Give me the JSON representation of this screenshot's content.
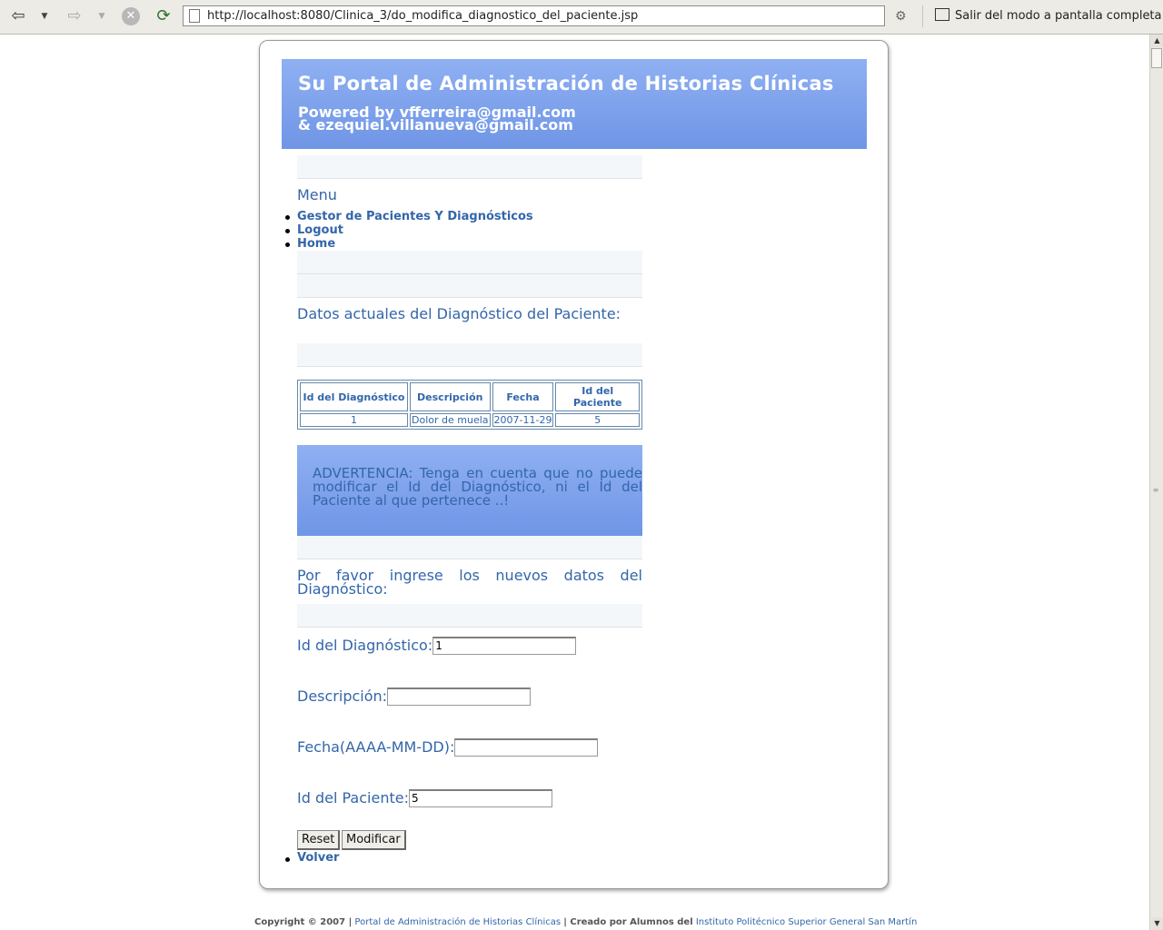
{
  "browser": {
    "back_icon": "back-arrow-icon",
    "forward_icon": "forward-arrow-icon",
    "url": "http://localhost:8080/Clinica_3/do_modifica_diagnostico_del_paciente.jsp",
    "fullscreen_label": "Salir del modo a pantalla completa"
  },
  "header": {
    "title": "Su Portal de Administración de Historias Clínicas",
    "powered_line1": "Powered by vfferreira@gmail.com",
    "powered_line2": "& ezequiel.villanueva@gmail.com"
  },
  "menu": {
    "title": "Menu",
    "items": [
      {
        "label": "Gestor de Pacientes Y Diagnósticos"
      },
      {
        "label": "Logout"
      },
      {
        "label": "Home"
      }
    ]
  },
  "current": {
    "heading": "Datos actuales del Diagnóstico del Paciente:",
    "table": {
      "headers": [
        "Id del Diagnóstico",
        "Descripción",
        "Fecha",
        "Id del Paciente"
      ],
      "rows": [
        [
          "1",
          "Dolor de muela",
          "2007-11-29",
          "5"
        ]
      ]
    }
  },
  "warning": "ADVERTENCIA: Tenga en cuenta que no puede modificar el Id del Diagnóstico, ni el Id del Paciente al que pertenece ..!",
  "form": {
    "heading": "Por favor ingrese los nuevos datos del Diagnóstico:",
    "fields": {
      "id_diagnostico": {
        "label": "Id del Diagnóstico:",
        "value": "1"
      },
      "descripcion": {
        "label": "Descripción:",
        "value": ""
      },
      "fecha": {
        "label": "Fecha(AAAA-MM-DD):",
        "value": ""
      },
      "id_paciente": {
        "label": "Id del Paciente:",
        "value": "5"
      }
    },
    "reset_label": "Reset",
    "submit_label": "Modificar",
    "back_link": "Volver"
  },
  "footer": {
    "copyright": "Copyright © 2007 |",
    "portal_link": "Portal de Administración de Historias Clínicas",
    "created_by": "| Creado por Alumnos del",
    "institute_link": "Instituto Politécnico Superior General San Martín"
  }
}
